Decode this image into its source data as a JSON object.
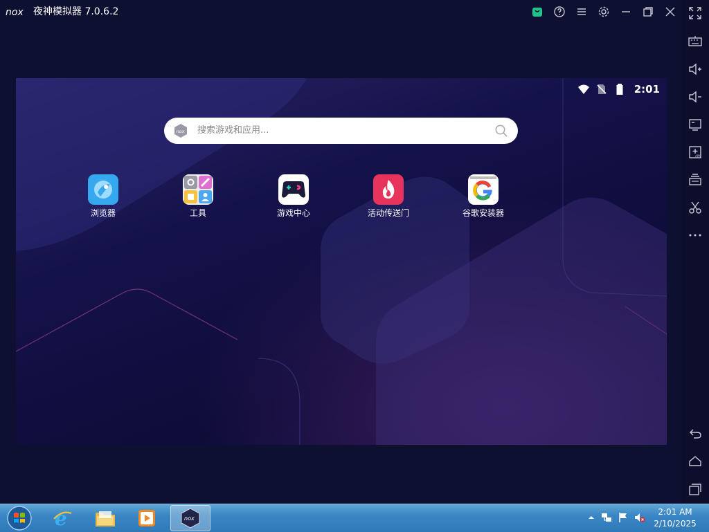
{
  "window": {
    "logo_text": "nox",
    "title": "夜神模拟器 7.0.6.2",
    "titlebar_buttons": [
      "shop-icon",
      "help-icon",
      "menu-icon",
      "settings-icon",
      "minimize-icon",
      "restore-icon",
      "close-icon"
    ]
  },
  "sidebar": {
    "tools": [
      "fullscreen-icon",
      "keyboard-icon",
      "volume-up-icon",
      "volume-down-icon",
      "screen-icon",
      "add-apk-icon",
      "multi-instance-icon",
      "scissors-icon",
      "more-icon"
    ],
    "nav": [
      "back-icon",
      "home-icon",
      "recent-apps-icon"
    ]
  },
  "android": {
    "status_bar": {
      "time": "2:01",
      "icons": [
        "wifi-icon",
        "no-sim-icon",
        "battery-icon"
      ]
    },
    "search": {
      "placeholder": "搜索游戏和应用..."
    },
    "app_icons": [
      {
        "label": "浏览器",
        "icon": "browser-icon"
      },
      {
        "label": "工具",
        "icon": "tools-icon"
      },
      {
        "label": "游戏中心",
        "icon": "game-center-icon"
      },
      {
        "label": "活动传送门",
        "icon": "event-portal-icon"
      },
      {
        "label": "谷歌安装器",
        "icon": "google-installer-icon"
      }
    ]
  },
  "taskbar": {
    "items": [
      "start-button",
      "internet-explorer-icon",
      "file-explorer-icon",
      "media-player-icon",
      "nox-taskbar-icon"
    ],
    "tray_icons": [
      "show-hidden-icons",
      "network-icon",
      "action-center-flag-icon",
      "volume-muted-icon"
    ],
    "clock_time": "2:01 AM",
    "clock_date": "2/10/2025"
  },
  "colors": {
    "window_bg": "#0e1031",
    "accent_green": "#1ec48a",
    "taskbar": "#3a86c4"
  }
}
